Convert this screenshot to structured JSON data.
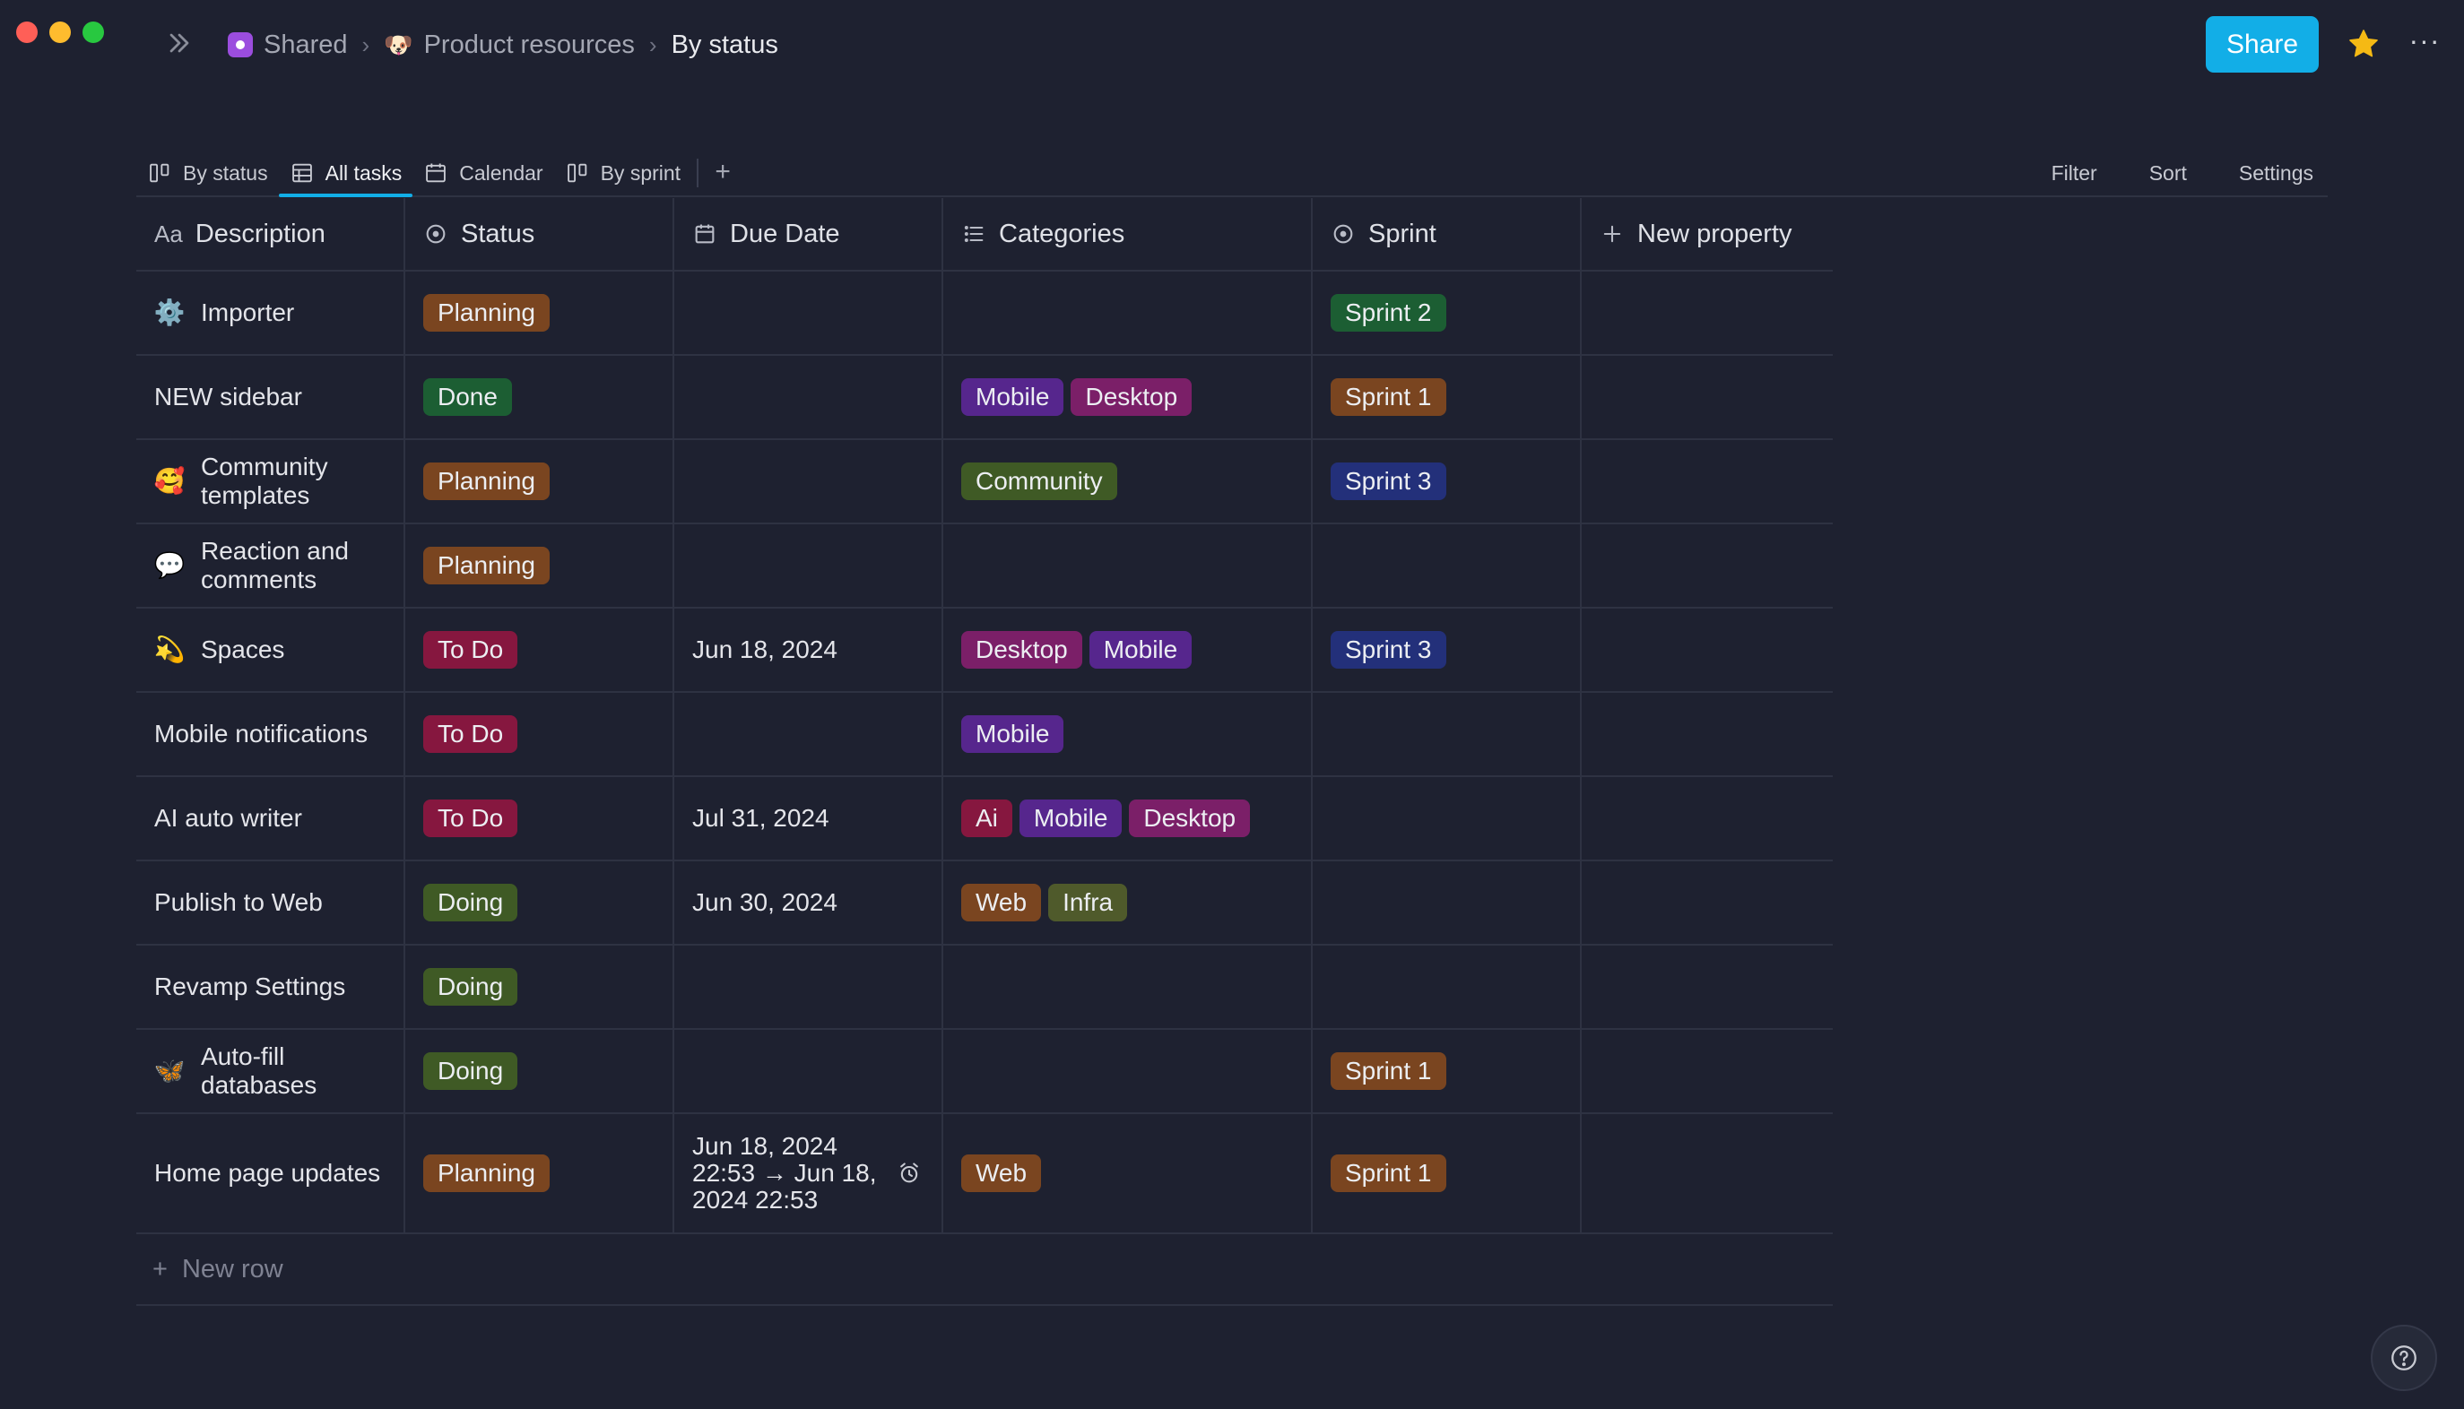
{
  "window": {
    "traffic_lights": [
      "close",
      "minimize",
      "zoom"
    ]
  },
  "breadcrumb": {
    "items": [
      {
        "label": "Shared",
        "icon": "space-icon"
      },
      {
        "label": "Product resources",
        "icon": "dog-emoji-icon"
      },
      {
        "label": "By status",
        "icon": ""
      }
    ],
    "separator_icon": "chevron-right-icon"
  },
  "header": {
    "share_label": "Share",
    "share_color": "#12aee7",
    "favorite_icon": "star-icon",
    "favorite_color": "#f5b914",
    "more_icon": "more-horizontal-icon",
    "more_label": "···"
  },
  "views": {
    "tabs": [
      {
        "label": "By status",
        "icon": "board-icon",
        "active": false
      },
      {
        "label": "All tasks",
        "icon": "table-icon",
        "active": true
      },
      {
        "label": "Calendar",
        "icon": "calendar-icon",
        "active": false
      },
      {
        "label": "By sprint",
        "icon": "board-icon",
        "active": false
      }
    ],
    "add_label": "+",
    "actions": {
      "filter": "Filter",
      "sort": "Sort",
      "settings": "Settings"
    }
  },
  "table": {
    "columns": [
      {
        "label": "Description",
        "icon": "text-aa-icon",
        "icon_text": "Aa"
      },
      {
        "label": "Status",
        "icon": "status-circle-icon"
      },
      {
        "label": "Due Date",
        "icon": "calendar-icon"
      },
      {
        "label": "Categories",
        "icon": "list-icon"
      },
      {
        "label": "Sprint",
        "icon": "status-circle-icon"
      },
      {
        "label": "New property",
        "icon": "plus-icon"
      }
    ],
    "rows": [
      {
        "icon": "⚙️",
        "desc": "Importer",
        "status": "Planning",
        "due": "",
        "categories": [],
        "sprint": "Sprint 2"
      },
      {
        "icon": "",
        "desc": "NEW sidebar",
        "status": "Done",
        "due": "",
        "categories": [
          "Mobile",
          "Desktop"
        ],
        "sprint": "Sprint 1"
      },
      {
        "icon": "🥰",
        "desc": "Community templates",
        "status": "Planning",
        "due": "",
        "categories": [
          "Community"
        ],
        "sprint": "Sprint 3"
      },
      {
        "icon": "💬",
        "desc": "Reaction and comments",
        "status": "Planning",
        "due": "",
        "categories": [],
        "sprint": ""
      },
      {
        "icon": "💫",
        "desc": "Spaces",
        "status": "To Do",
        "due": "Jun 18, 2024",
        "categories": [
          "Desktop",
          "Mobile"
        ],
        "sprint": "Sprint 3"
      },
      {
        "icon": "",
        "desc": "Mobile notifications",
        "status": "To Do",
        "due": "",
        "categories": [
          "Mobile"
        ],
        "sprint": ""
      },
      {
        "icon": "",
        "desc": "AI auto writer",
        "status": "To Do",
        "due": "Jul 31, 2024",
        "categories": [
          "Ai",
          "Mobile",
          "Desktop"
        ],
        "sprint": ""
      },
      {
        "icon": "",
        "desc": "Publish to Web",
        "status": "Doing",
        "due": "Jun 30, 2024",
        "categories": [
          "Web",
          "Infra"
        ],
        "sprint": ""
      },
      {
        "icon": "",
        "desc": "Revamp Settings",
        "status": "Doing",
        "due": "",
        "categories": [],
        "sprint": ""
      },
      {
        "icon": "🦋",
        "desc": "Auto-fill databases",
        "status": "Doing",
        "due": "",
        "categories": [],
        "sprint": "Sprint 1"
      },
      {
        "icon": "",
        "desc": "Home page updates",
        "status": "Planning",
        "due": "Jun 18, 2024 22:53 → Jun 18, 2024 22:53",
        "due_reminder": true,
        "categories": [
          "Web"
        ],
        "sprint": "Sprint 1"
      }
    ],
    "new_row_label": "New row"
  },
  "tag_colors": {
    "Planning": "#7a4520",
    "Done": "#1c5e33",
    "To Do": "#86173f",
    "Doing": "#3f5a25",
    "Mobile": "#56268d",
    "Desktop": "#7b1f68",
    "Community": "#3f5a25",
    "Ai": "#86173f",
    "Web": "#7a4520",
    "Infra": "#4f5a2b",
    "Sprint 1": "#7a4520",
    "Sprint 2": "#1c5e33",
    "Sprint 3": "#23307a"
  },
  "help": {
    "icon": "help-circle-icon",
    "label": "?"
  }
}
